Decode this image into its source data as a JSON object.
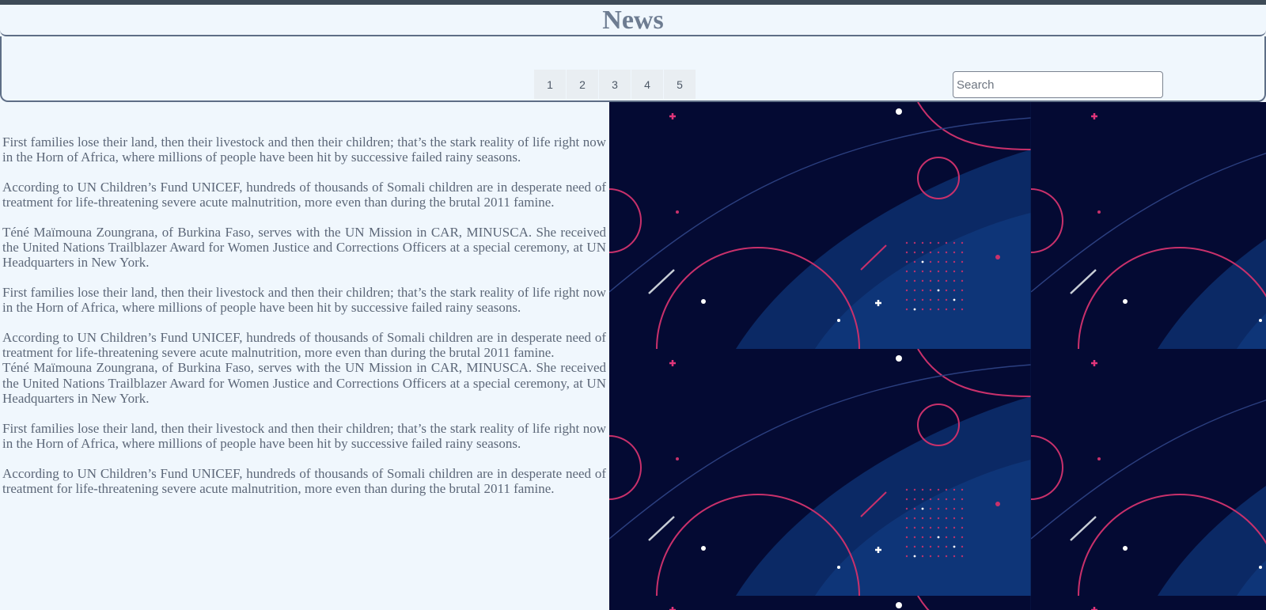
{
  "header": {
    "title": "News"
  },
  "pagination": {
    "pages": [
      "1",
      "2",
      "3",
      "4",
      "5"
    ]
  },
  "search": {
    "placeholder": "Search",
    "value": ""
  },
  "articles": [
    "First families lose their land, then their livestock and then their children; that’s the stark reality of life right now in the Horn of Africa, where millions of people have been hit by successive failed rainy seasons.",
    "According to UN Children’s Fund UNICEF, hundreds of thousands of Somali children are in desperate need of treatment for life-threatening severe acute malnutrition, more even than during the brutal 2011 famine.",
    "Téné Maïmouna Zoungrana, of Burkina Faso, serves with the UN Mission in CAR, MINUSCA. She received the United Nations Trailblazer Award for Women Justice and Corrections Officers at a special ceremony, at UN Headquarters in New York.",
    "First families lose their land, then their livestock and then their children; that’s the stark reality of life right now in the Horn of Africa, where millions of people have been hit by successive failed rainy seasons.",
    "According to UN Children’s Fund UNICEF, hundreds of thousands of Somali children are in desperate need of treatment for life-threatening severe acute malnutrition, more even than during the brutal 2011 famine.",
    "Téné Maïmouna Zoungrana, of Burkina Faso, serves with the UN Mission in CAR, MINUSCA. She received the United Nations Trailblazer Award for Women Justice and Corrections Officers at a special ceremony, at UN Headquarters in New York.",
    "First families lose their land, then their livestock and then their children; that’s the stark reality of life right now in the Horn of Africa, where millions of people have been hit by successive failed rainy seasons.",
    "According to UN Children’s Fund UNICEF, hundreds of thousands of Somali children are in desperate need of treatment for life-threatening severe acute malnutrition, more even than during the brutal 2011 famine."
  ],
  "colors": {
    "background": "#f0f7fd",
    "header_text": "#6d7c91",
    "border": "#5e6e86",
    "art_navy": "#050b33",
    "art_blue": "#0d3a7a",
    "art_pink": "#d8336f"
  }
}
